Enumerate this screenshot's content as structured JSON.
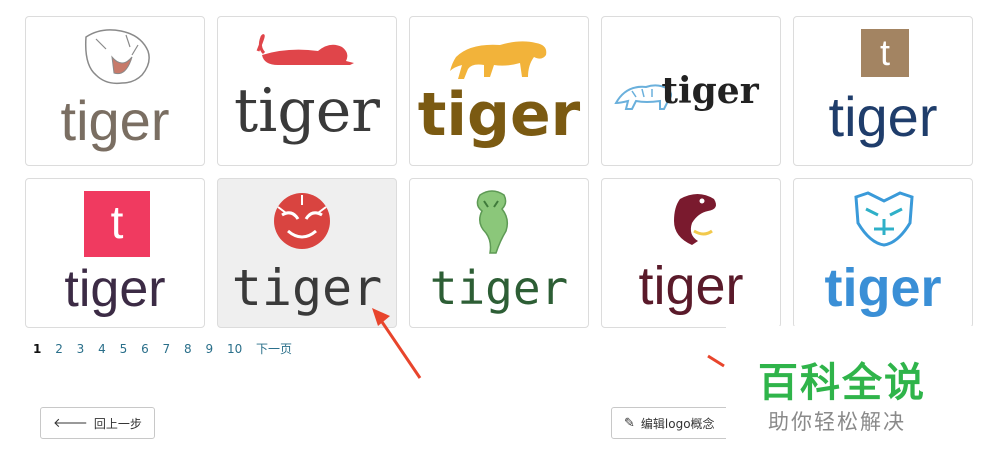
{
  "logos": [
    {
      "word": "tiger",
      "color": "#7a6e62",
      "icon": "roaring-tiger-head-sketch-icon"
    },
    {
      "word": "tiger",
      "color": "#3a3a3a",
      "icon": "lying-red-tiger-icon"
    },
    {
      "word": "tiger",
      "color": "#7b5a12",
      "icon": "yellow-walking-tiger-icon"
    },
    {
      "word": "tiger",
      "color": "#222222",
      "icon": "blue-outline-tiger-icon"
    },
    {
      "word": "tiger",
      "color": "#1f3d6b",
      "icon": "brown-t-square-icon",
      "badge": "t",
      "badge_color": "#a38462"
    },
    {
      "word": "tiger",
      "color": "#3c2b45",
      "icon": "pink-t-square-icon",
      "badge": "t",
      "badge_color": "#f03a60"
    },
    {
      "word": "tiger",
      "color": "#3a3a3a",
      "icon": "red-tiger-face-icon",
      "selected": true
    },
    {
      "word": "tiger",
      "color": "#2d5e35",
      "icon": "green-tiger-icon"
    },
    {
      "word": "tiger",
      "color": "#5a1a2a",
      "icon": "shrimp-icon"
    },
    {
      "word": "tiger",
      "color": "#3a8fd6",
      "icon": "blue-geometric-tiger-icon"
    }
  ],
  "pagination": {
    "pages": [
      "1",
      "2",
      "3",
      "4",
      "5",
      "6",
      "7",
      "8",
      "9",
      "10"
    ],
    "current": "1",
    "next_label": "下一页"
  },
  "buttons": {
    "back_label": "回上一步",
    "edit_label": "编辑logo概念"
  },
  "watermark": {
    "title": "百科全说",
    "subtitle": "助你轻松解决"
  },
  "colors": {
    "arrow": "#e8452c",
    "watermark_green": "#2fb44a"
  }
}
